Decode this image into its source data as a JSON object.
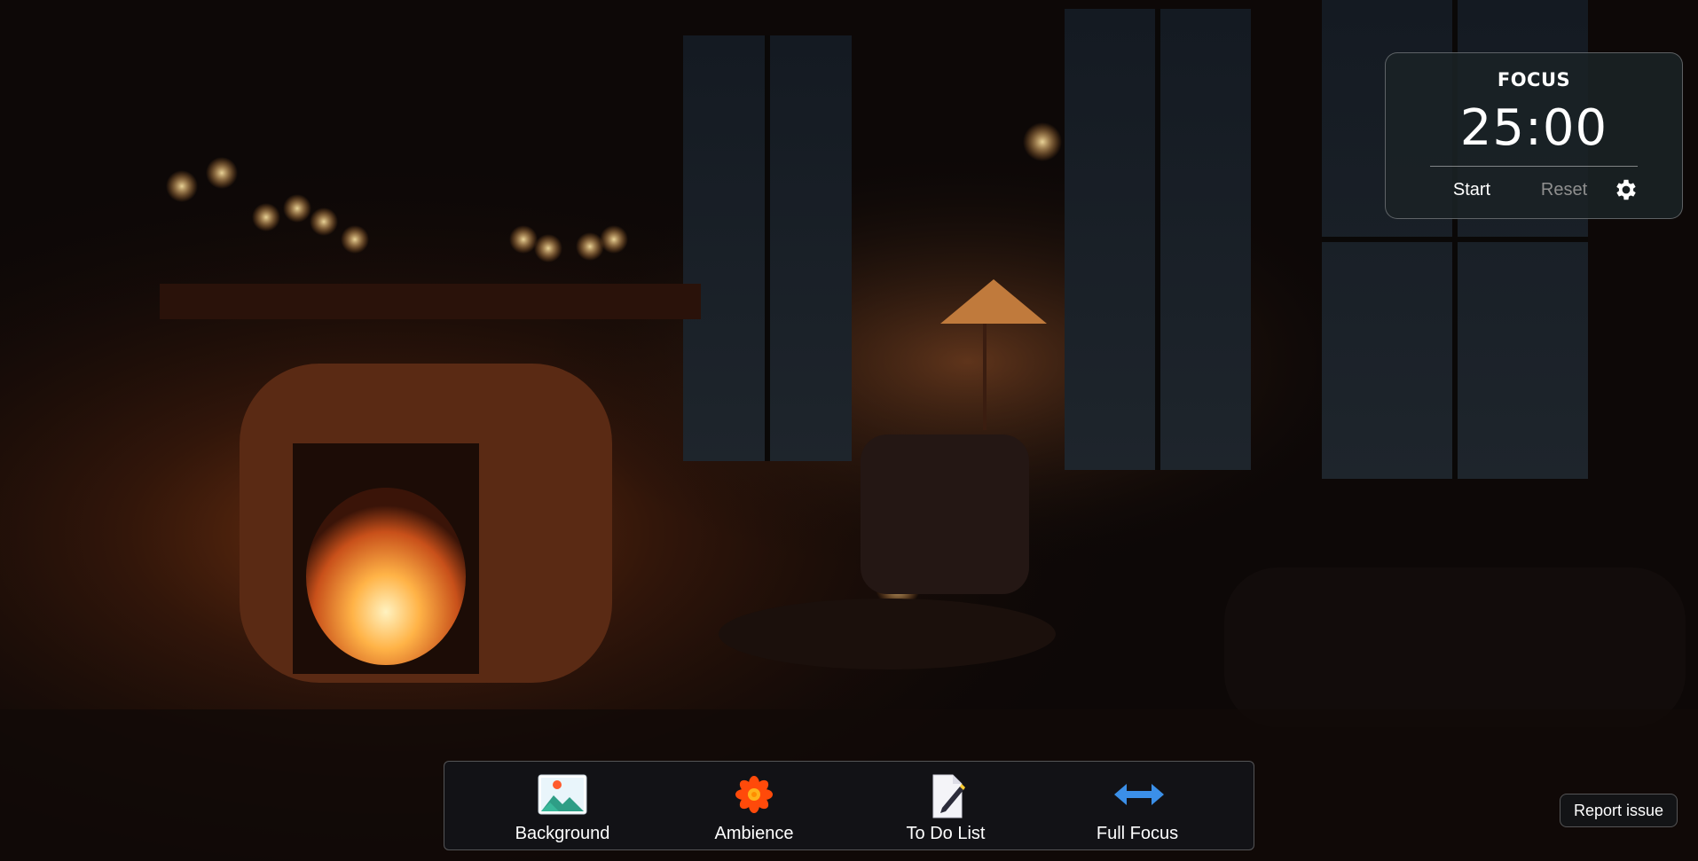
{
  "background": {
    "name": "fireplace-room-scene",
    "colors": {
      "base": "#0b0706",
      "fire": "#ffb347",
      "wall": "#3a1d12"
    }
  },
  "timer": {
    "mode": "FOCUS",
    "time": "25:00",
    "start_label": "Start",
    "reset_label": "Reset",
    "settings_icon": "gear-icon"
  },
  "toolbar": {
    "items": [
      {
        "label": "Background",
        "icon": "landscape-image-icon"
      },
      {
        "label": "Ambience",
        "icon": "flower-icon"
      },
      {
        "label": "To Do List",
        "icon": "note-pen-icon"
      },
      {
        "label": "Full Focus",
        "icon": "double-arrow-icon"
      }
    ]
  },
  "report_issue_label": "Report issue"
}
